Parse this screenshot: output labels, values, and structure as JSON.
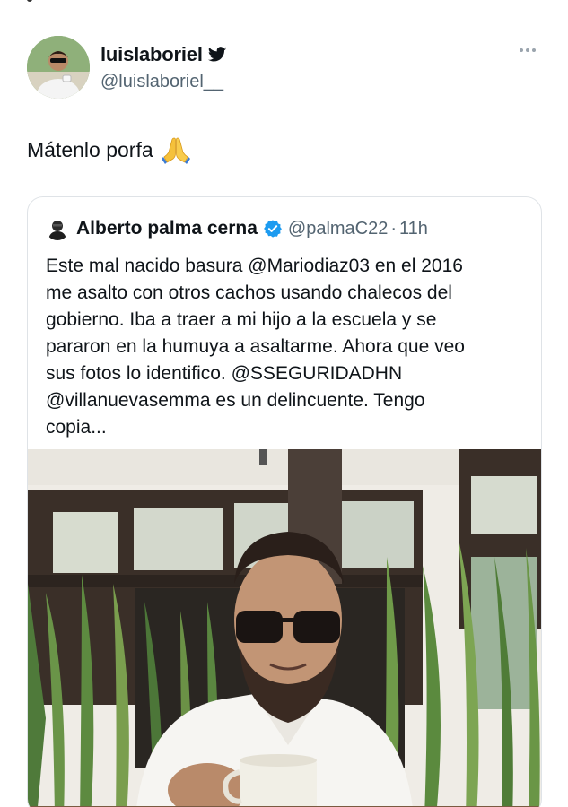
{
  "tweet": {
    "display_name": "luislaboriel",
    "handle": "@luislaboriel__",
    "text": "Mátenlo porfa",
    "emoji": "folded-hands",
    "verified_badge": "twitter-bird-icon",
    "menu_icon": "more-icon"
  },
  "quoted": {
    "display_name": "Alberto palma cerna",
    "handle": "@palmaC22",
    "separator": "·",
    "time": "11h",
    "verified_badge": "verified-icon",
    "body_lines": [
      "Este mal nacido basura @Mariodiaz03 en el 2016",
      "me asalto con otros cachos usando chalecos del",
      "gobierno. Iba a traer a mi hijo a la escuela y se",
      "pararon en la humuya a asaltarme. Ahora que veo",
      "sus fotos lo identifico. @SSEGURIDADHN",
      "@villanuevasemma  es un delincuente. Tengo",
      "copia..."
    ],
    "photo": "man-with-sunglasses-holding-cup"
  },
  "colors": {
    "text": "#0f1419",
    "secondary": "#536471",
    "link_blue": "#1d9bf0",
    "border": "#dfe3e7"
  }
}
